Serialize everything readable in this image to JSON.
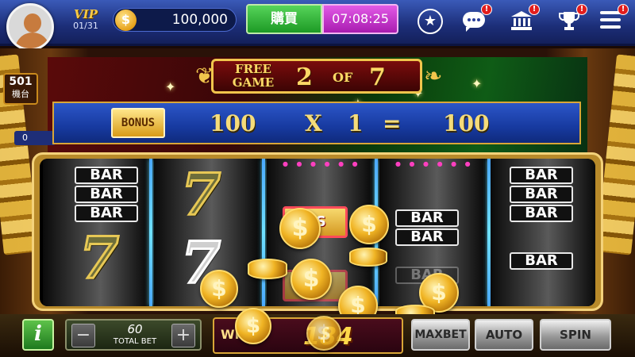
{
  "header": {
    "vip_label": "VIP",
    "vip_progress": "01/31",
    "coin_icon": "$",
    "balance": "100,000",
    "buy_label": "購買",
    "clock": "07:08:25",
    "star_icon": "★",
    "badge_mark": "!",
    "icons": [
      "star-icon",
      "chat-icon",
      "bank-icon",
      "trophy-icon",
      "menu-icon"
    ]
  },
  "side": {
    "machine_no": "501",
    "machine_label": "機台",
    "count": "0"
  },
  "free_game": {
    "line1": "FREE",
    "line2": "GAME",
    "current": "2",
    "of": "OF",
    "total": "7"
  },
  "bonus_calc": {
    "tile": "BONUS",
    "base": "100",
    "times": "X",
    "multiplier": "1",
    "equals": "=",
    "result": "100"
  },
  "reels": {
    "bar": "BAR",
    "seven": "7",
    "bonus_partial": "US",
    "coin": "$"
  },
  "bottom": {
    "info": "i",
    "minus": "−",
    "plus": "+",
    "total_bet_value": "60",
    "total_bet_label": "TOTAL  BET",
    "win_label": "WIN",
    "win_value": "184",
    "maxbet": "MAXBET",
    "auto": "AUTO",
    "spin": "SPIN"
  },
  "colors": {
    "header_blue": "#1c2e78",
    "buy_green": "#1d9a25",
    "clock_magenta": "#a81cb0",
    "gold": "#f1c54c",
    "badge_red": "#e21d1d"
  }
}
